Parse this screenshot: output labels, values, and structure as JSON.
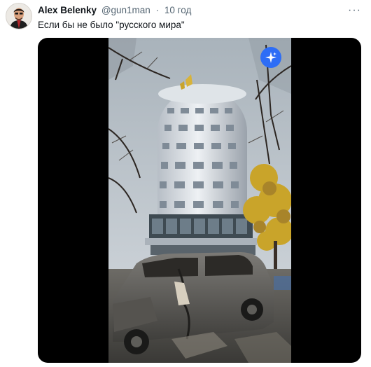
{
  "tweet": {
    "author_name": "Alex Belenky",
    "handle": "@gun1man",
    "separator": "·",
    "time": "10 год",
    "more_label": "···",
    "text": "Если бы не было \"русского мира\""
  },
  "colors": {
    "text_primary": "#0f1419",
    "text_secondary": "#536471",
    "media_background": "#000000",
    "ai_button": "#2d6df6"
  },
  "icons": {
    "more": "more-icon",
    "ai": "sparkle-icon"
  }
}
